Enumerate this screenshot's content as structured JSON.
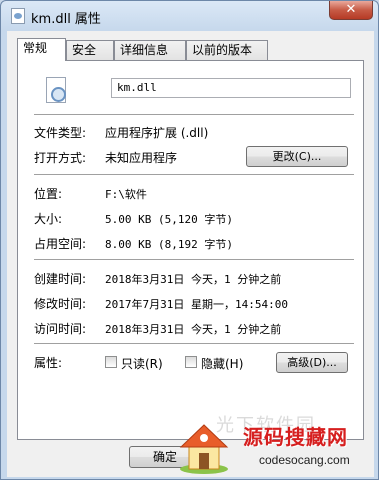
{
  "window": {
    "title": "km.dll 属性",
    "close_glyph": "✕"
  },
  "tabs": [
    {
      "label": "常规",
      "active": true
    },
    {
      "label": "安全",
      "active": false
    },
    {
      "label": "详细信息",
      "active": false
    },
    {
      "label": "以前的版本",
      "active": false
    }
  ],
  "general": {
    "file_name": "km.dll",
    "file_type_label": "文件类型:",
    "file_type_value": "应用程序扩展 (.dll)",
    "open_with_label": "打开方式:",
    "open_with_value": "未知应用程序",
    "change_button": "更改(C)...",
    "location_label": "位置:",
    "location_value": "F:\\软件",
    "size_label": "大小:",
    "size_value": "5.00 KB (5,120 字节)",
    "size_on_disk_label": "占用空间:",
    "size_on_disk_value": "8.00 KB (8,192 字节)",
    "created_label": "创建时间:",
    "created_value": "2018年3月31日 今天，1 分钟之前",
    "modified_label": "修改时间:",
    "modified_value": "2017年7月31日 星期一，14:54:00",
    "accessed_label": "访问时间:",
    "accessed_value": "2018年3月31日 今天，1 分钟之前",
    "attributes_label": "属性:",
    "readonly_label": "只读(R)",
    "hidden_label": "隐藏(H)",
    "advanced_button": "高级(D)..."
  },
  "footer": {
    "ok_button": "确定"
  },
  "watermark": {
    "brand": "源码搜藏网",
    "url": "codesocang.com",
    "faint": "光下软件园"
  }
}
